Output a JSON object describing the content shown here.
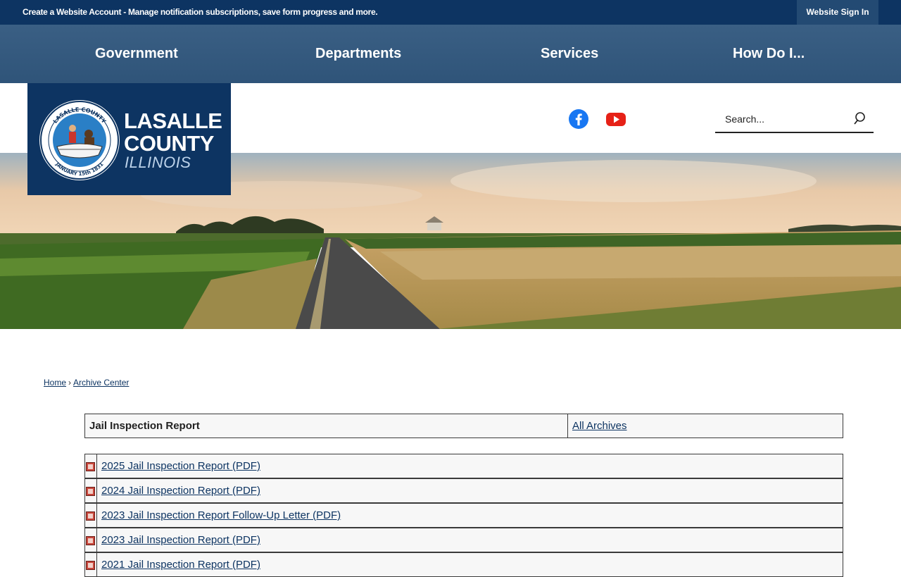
{
  "topbar": {
    "message": "Create a Website Account - Manage notification subscriptions, save form progress and more.",
    "signin_label": "Website Sign In"
  },
  "nav": [
    "Government",
    "Departments",
    "Services",
    "How Do I..."
  ],
  "logo": {
    "line1": "LASALLE",
    "line2": "COUNTY",
    "line3": "ILLINOIS",
    "seal_top": "LASALLE COUNTY",
    "seal_bottom": "JANUARY 15th 1831"
  },
  "social": [
    "facebook-icon",
    "youtube-icon"
  ],
  "search": {
    "placeholder": "Search..."
  },
  "breadcrumb": {
    "home": "Home",
    "separator": "›",
    "current": "Archive Center"
  },
  "archive": {
    "title": "Jail Inspection Report",
    "all_archives": "All Archives",
    "items": [
      "2025 Jail Inspection Report (PDF)",
      "2024 Jail Inspection Report (PDF)",
      "2023 Jail Inspection Report Follow-Up Letter (PDF)",
      "2023 Jail Inspection Report (PDF)",
      "2021 Jail Inspection Report (PDF)"
    ]
  },
  "colors": {
    "brand_navy": "#0d3462",
    "nav_blue": "#345a80",
    "facebook": "#1877f2",
    "youtube": "#e62117"
  }
}
